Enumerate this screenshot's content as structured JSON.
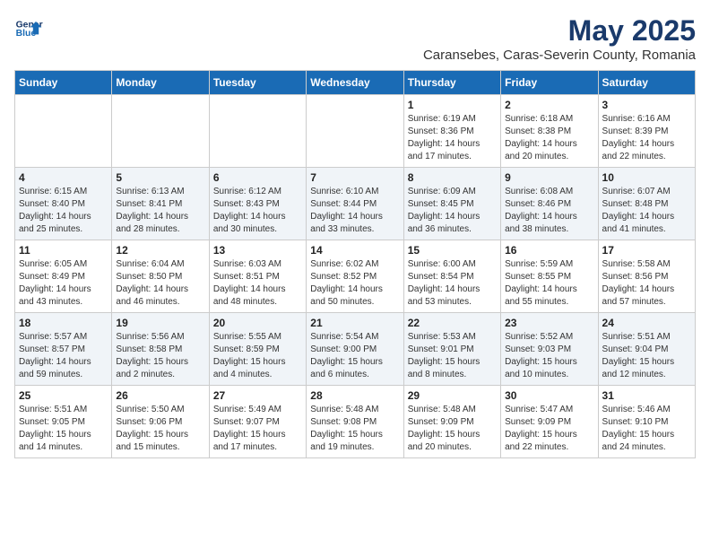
{
  "header": {
    "logo_line1": "General",
    "logo_line2": "Blue",
    "month": "May 2025",
    "location": "Caransebes, Caras-Severin County, Romania"
  },
  "weekdays": [
    "Sunday",
    "Monday",
    "Tuesday",
    "Wednesday",
    "Thursday",
    "Friday",
    "Saturday"
  ],
  "weeks": [
    [
      {
        "day": "",
        "detail": ""
      },
      {
        "day": "",
        "detail": ""
      },
      {
        "day": "",
        "detail": ""
      },
      {
        "day": "",
        "detail": ""
      },
      {
        "day": "1",
        "detail": "Sunrise: 6:19 AM\nSunset: 8:36 PM\nDaylight: 14 hours\nand 17 minutes."
      },
      {
        "day": "2",
        "detail": "Sunrise: 6:18 AM\nSunset: 8:38 PM\nDaylight: 14 hours\nand 20 minutes."
      },
      {
        "day": "3",
        "detail": "Sunrise: 6:16 AM\nSunset: 8:39 PM\nDaylight: 14 hours\nand 22 minutes."
      }
    ],
    [
      {
        "day": "4",
        "detail": "Sunrise: 6:15 AM\nSunset: 8:40 PM\nDaylight: 14 hours\nand 25 minutes."
      },
      {
        "day": "5",
        "detail": "Sunrise: 6:13 AM\nSunset: 8:41 PM\nDaylight: 14 hours\nand 28 minutes."
      },
      {
        "day": "6",
        "detail": "Sunrise: 6:12 AM\nSunset: 8:43 PM\nDaylight: 14 hours\nand 30 minutes."
      },
      {
        "day": "7",
        "detail": "Sunrise: 6:10 AM\nSunset: 8:44 PM\nDaylight: 14 hours\nand 33 minutes."
      },
      {
        "day": "8",
        "detail": "Sunrise: 6:09 AM\nSunset: 8:45 PM\nDaylight: 14 hours\nand 36 minutes."
      },
      {
        "day": "9",
        "detail": "Sunrise: 6:08 AM\nSunset: 8:46 PM\nDaylight: 14 hours\nand 38 minutes."
      },
      {
        "day": "10",
        "detail": "Sunrise: 6:07 AM\nSunset: 8:48 PM\nDaylight: 14 hours\nand 41 minutes."
      }
    ],
    [
      {
        "day": "11",
        "detail": "Sunrise: 6:05 AM\nSunset: 8:49 PM\nDaylight: 14 hours\nand 43 minutes."
      },
      {
        "day": "12",
        "detail": "Sunrise: 6:04 AM\nSunset: 8:50 PM\nDaylight: 14 hours\nand 46 minutes."
      },
      {
        "day": "13",
        "detail": "Sunrise: 6:03 AM\nSunset: 8:51 PM\nDaylight: 14 hours\nand 48 minutes."
      },
      {
        "day": "14",
        "detail": "Sunrise: 6:02 AM\nSunset: 8:52 PM\nDaylight: 14 hours\nand 50 minutes."
      },
      {
        "day": "15",
        "detail": "Sunrise: 6:00 AM\nSunset: 8:54 PM\nDaylight: 14 hours\nand 53 minutes."
      },
      {
        "day": "16",
        "detail": "Sunrise: 5:59 AM\nSunset: 8:55 PM\nDaylight: 14 hours\nand 55 minutes."
      },
      {
        "day": "17",
        "detail": "Sunrise: 5:58 AM\nSunset: 8:56 PM\nDaylight: 14 hours\nand 57 minutes."
      }
    ],
    [
      {
        "day": "18",
        "detail": "Sunrise: 5:57 AM\nSunset: 8:57 PM\nDaylight: 14 hours\nand 59 minutes."
      },
      {
        "day": "19",
        "detail": "Sunrise: 5:56 AM\nSunset: 8:58 PM\nDaylight: 15 hours\nand 2 minutes."
      },
      {
        "day": "20",
        "detail": "Sunrise: 5:55 AM\nSunset: 8:59 PM\nDaylight: 15 hours\nand 4 minutes."
      },
      {
        "day": "21",
        "detail": "Sunrise: 5:54 AM\nSunset: 9:00 PM\nDaylight: 15 hours\nand 6 minutes."
      },
      {
        "day": "22",
        "detail": "Sunrise: 5:53 AM\nSunset: 9:01 PM\nDaylight: 15 hours\nand 8 minutes."
      },
      {
        "day": "23",
        "detail": "Sunrise: 5:52 AM\nSunset: 9:03 PM\nDaylight: 15 hours\nand 10 minutes."
      },
      {
        "day": "24",
        "detail": "Sunrise: 5:51 AM\nSunset: 9:04 PM\nDaylight: 15 hours\nand 12 minutes."
      }
    ],
    [
      {
        "day": "25",
        "detail": "Sunrise: 5:51 AM\nSunset: 9:05 PM\nDaylight: 15 hours\nand 14 minutes."
      },
      {
        "day": "26",
        "detail": "Sunrise: 5:50 AM\nSunset: 9:06 PM\nDaylight: 15 hours\nand 15 minutes."
      },
      {
        "day": "27",
        "detail": "Sunrise: 5:49 AM\nSunset: 9:07 PM\nDaylight: 15 hours\nand 17 minutes."
      },
      {
        "day": "28",
        "detail": "Sunrise: 5:48 AM\nSunset: 9:08 PM\nDaylight: 15 hours\nand 19 minutes."
      },
      {
        "day": "29",
        "detail": "Sunrise: 5:48 AM\nSunset: 9:09 PM\nDaylight: 15 hours\nand 20 minutes."
      },
      {
        "day": "30",
        "detail": "Sunrise: 5:47 AM\nSunset: 9:09 PM\nDaylight: 15 hours\nand 22 minutes."
      },
      {
        "day": "31",
        "detail": "Sunrise: 5:46 AM\nSunset: 9:10 PM\nDaylight: 15 hours\nand 24 minutes."
      }
    ]
  ]
}
